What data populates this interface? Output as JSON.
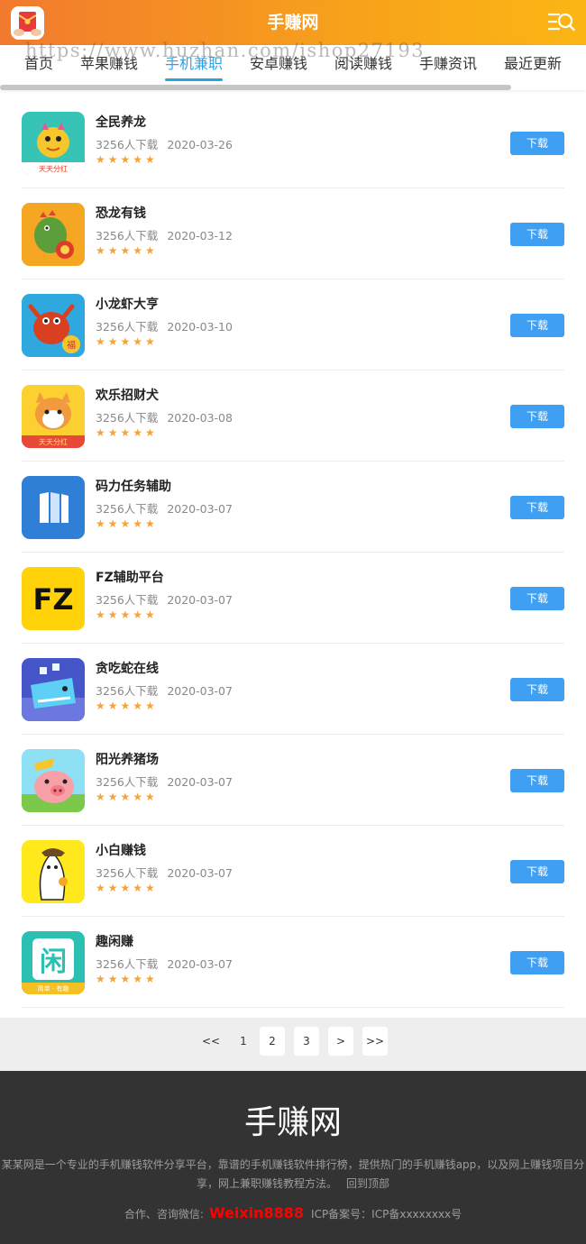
{
  "header": {
    "title": "手赚网",
    "logo_icon": "red-envelope-icon",
    "menu_icon": "menu-search-icon",
    "gradient_from": "#f27a2e",
    "gradient_to": "#fbb614"
  },
  "watermark": "https://www.huzhan.com/ishop27193",
  "nav": {
    "items": [
      {
        "label": "首页"
      },
      {
        "label": "苹果赚钱"
      },
      {
        "label": "手机兼职",
        "active": true
      },
      {
        "label": "安卓赚钱"
      },
      {
        "label": "阅读赚钱"
      },
      {
        "label": "手赚资讯"
      },
      {
        "label": "最近更新"
      }
    ],
    "active_color": "#2aa3e6"
  },
  "apps": [
    {
      "name": "全民养龙",
      "downloads": "3256人下载",
      "date": "2020-03-26",
      "stars": "★★★★★",
      "button": "下载",
      "icon": "yellow-dragon-icon",
      "icon_text": "天天分红"
    },
    {
      "name": "恐龙有钱",
      "downloads": "3256人下载",
      "date": "2020-03-12",
      "stars": "★★★★★",
      "button": "下载",
      "icon": "green-dinosaur-icon"
    },
    {
      "name": "小龙虾大亨",
      "downloads": "3256人下载",
      "date": "2020-03-10",
      "stars": "★★★★★",
      "button": "下载",
      "icon": "crayfish-icon",
      "icon_text": "福"
    },
    {
      "name": "欢乐招财犬",
      "downloads": "3256人下载",
      "date": "2020-03-08",
      "stars": "★★★★★",
      "button": "下载",
      "icon": "shiba-dog-icon",
      "icon_text": "天天分红"
    },
    {
      "name": "码力任务辅助",
      "downloads": "3256人下载",
      "date": "2020-03-07",
      "stars": "★★★★★",
      "button": "下载",
      "icon": "blue-book-icon"
    },
    {
      "name": "FZ辅助平台",
      "downloads": "3256人下载",
      "date": "2020-03-07",
      "stars": "★★★★★",
      "button": "下载",
      "icon": "fz-logo-icon",
      "icon_text": "FZ"
    },
    {
      "name": "贪吃蛇在线",
      "downloads": "3256人下载",
      "date": "2020-03-07",
      "stars": "★★★★★",
      "button": "下载",
      "icon": "blue-whale-icon"
    },
    {
      "name": "阳光养猪场",
      "downloads": "3256人下载",
      "date": "2020-03-07",
      "stars": "★★★★★",
      "button": "下载",
      "icon": "pig-icon"
    },
    {
      "name": "小白赚钱",
      "downloads": "3256人下载",
      "date": "2020-03-07",
      "stars": "★★★★★",
      "button": "下载",
      "icon": "white-chick-icon"
    },
    {
      "name": "趣闲赚",
      "downloads": "3256人下载",
      "date": "2020-03-07",
      "stars": "★★★★★",
      "button": "下载",
      "icon": "qu-xian-zhuan-icon",
      "icon_text": "闲",
      "icon_subtext": "简单 · 有趣"
    }
  ],
  "pagination": {
    "prev": "<<",
    "pages": [
      "1",
      "2",
      "3"
    ],
    "next": ">",
    "last": ">>"
  },
  "footer": {
    "title": "手赚网",
    "description": "某某网是一个专业的手机赚钱软件分享平台，靠谱的手机赚钱软件排行榜，提供热门的手机赚钱app，以及网上赚钱项目分享，网上兼职赚钱教程方法。",
    "back_to_top": "回到顶部",
    "contact_label": "合作、咨询微信:",
    "wechat": "Weixin8888",
    "icp": "ICP备案号：ICP备xxxxxxxx号"
  },
  "colors": {
    "button_blue": "#3fa0f3",
    "star_orange": "#f5a33a",
    "footer_bg": "#333333",
    "wechat_red": "#ff0000"
  }
}
